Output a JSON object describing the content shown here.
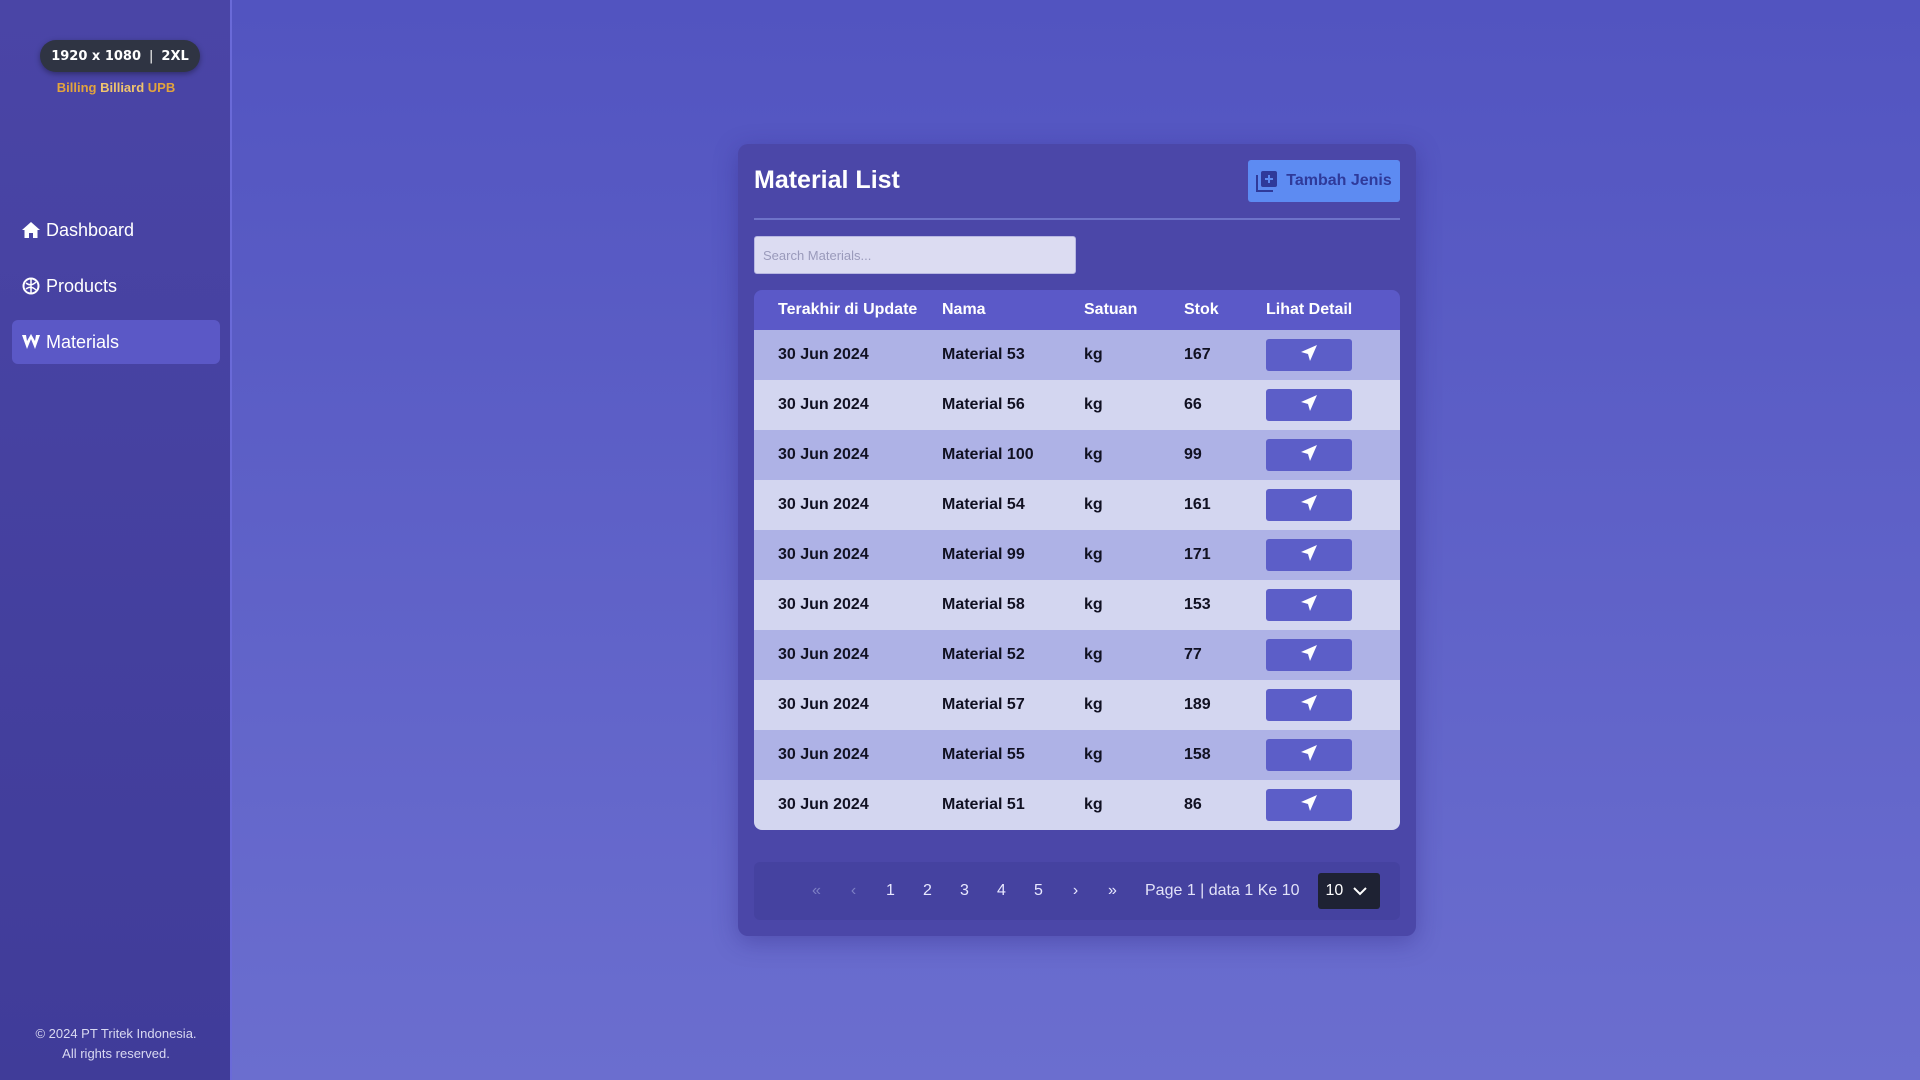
{
  "sidebar": {
    "size_badge": {
      "resolution": "1920 x 1080",
      "separator": "|",
      "breakpoint": "2XL"
    },
    "brand": {
      "part1": "Billing ",
      "part2": "Billiard",
      "part3": " UPB"
    },
    "items": [
      {
        "label": "Dashboard",
        "icon": "home-icon"
      },
      {
        "label": "Products",
        "icon": "products-icon"
      },
      {
        "label": "Materials",
        "icon": "materials-icon",
        "active": true
      }
    ],
    "footer": {
      "line1": "© 2024 PT Tritek Indonesia.",
      "line2": "All rights reserved."
    }
  },
  "main": {
    "title": "Material List",
    "add_button": {
      "label": "Tambah Jenis",
      "icon": "add-box-icon"
    },
    "search": {
      "placeholder": "Search Materials...",
      "value": ""
    },
    "table": {
      "columns": [
        "Terakhir di Update",
        "Nama",
        "Satuan",
        "Stok",
        "Lihat Detail"
      ],
      "rows": [
        {
          "updated": "30 Jun 2024",
          "name": "Material 53",
          "unit": "kg",
          "stock": "167"
        },
        {
          "updated": "30 Jun 2024",
          "name": "Material 56",
          "unit": "kg",
          "stock": "66"
        },
        {
          "updated": "30 Jun 2024",
          "name": "Material 100",
          "unit": "kg",
          "stock": "99"
        },
        {
          "updated": "30 Jun 2024",
          "name": "Material 54",
          "unit": "kg",
          "stock": "161"
        },
        {
          "updated": "30 Jun 2024",
          "name": "Material 99",
          "unit": "kg",
          "stock": "171"
        },
        {
          "updated": "30 Jun 2024",
          "name": "Material 58",
          "unit": "kg",
          "stock": "153"
        },
        {
          "updated": "30 Jun 2024",
          "name": "Material 52",
          "unit": "kg",
          "stock": "77"
        },
        {
          "updated": "30 Jun 2024",
          "name": "Material 57",
          "unit": "kg",
          "stock": "189"
        },
        {
          "updated": "30 Jun 2024",
          "name": "Material 55",
          "unit": "kg",
          "stock": "158"
        },
        {
          "updated": "30 Jun 2024",
          "name": "Material 51",
          "unit": "kg",
          "stock": "86"
        }
      ],
      "detail_icon": "navigate-arrow-icon"
    },
    "pagination": {
      "first": "«",
      "prev": "‹",
      "pages": [
        "1",
        "2",
        "3",
        "4",
        "5"
      ],
      "next": "›",
      "last": "»",
      "info": "Page 1 | data 1 Ke 10",
      "per_page": "10"
    }
  },
  "colors": {
    "background": "#5254c0",
    "sidebar": "#4a45a6",
    "card": "#4b47a8",
    "accent_button": "#5d8bf2",
    "brand": "#e3a43c"
  }
}
